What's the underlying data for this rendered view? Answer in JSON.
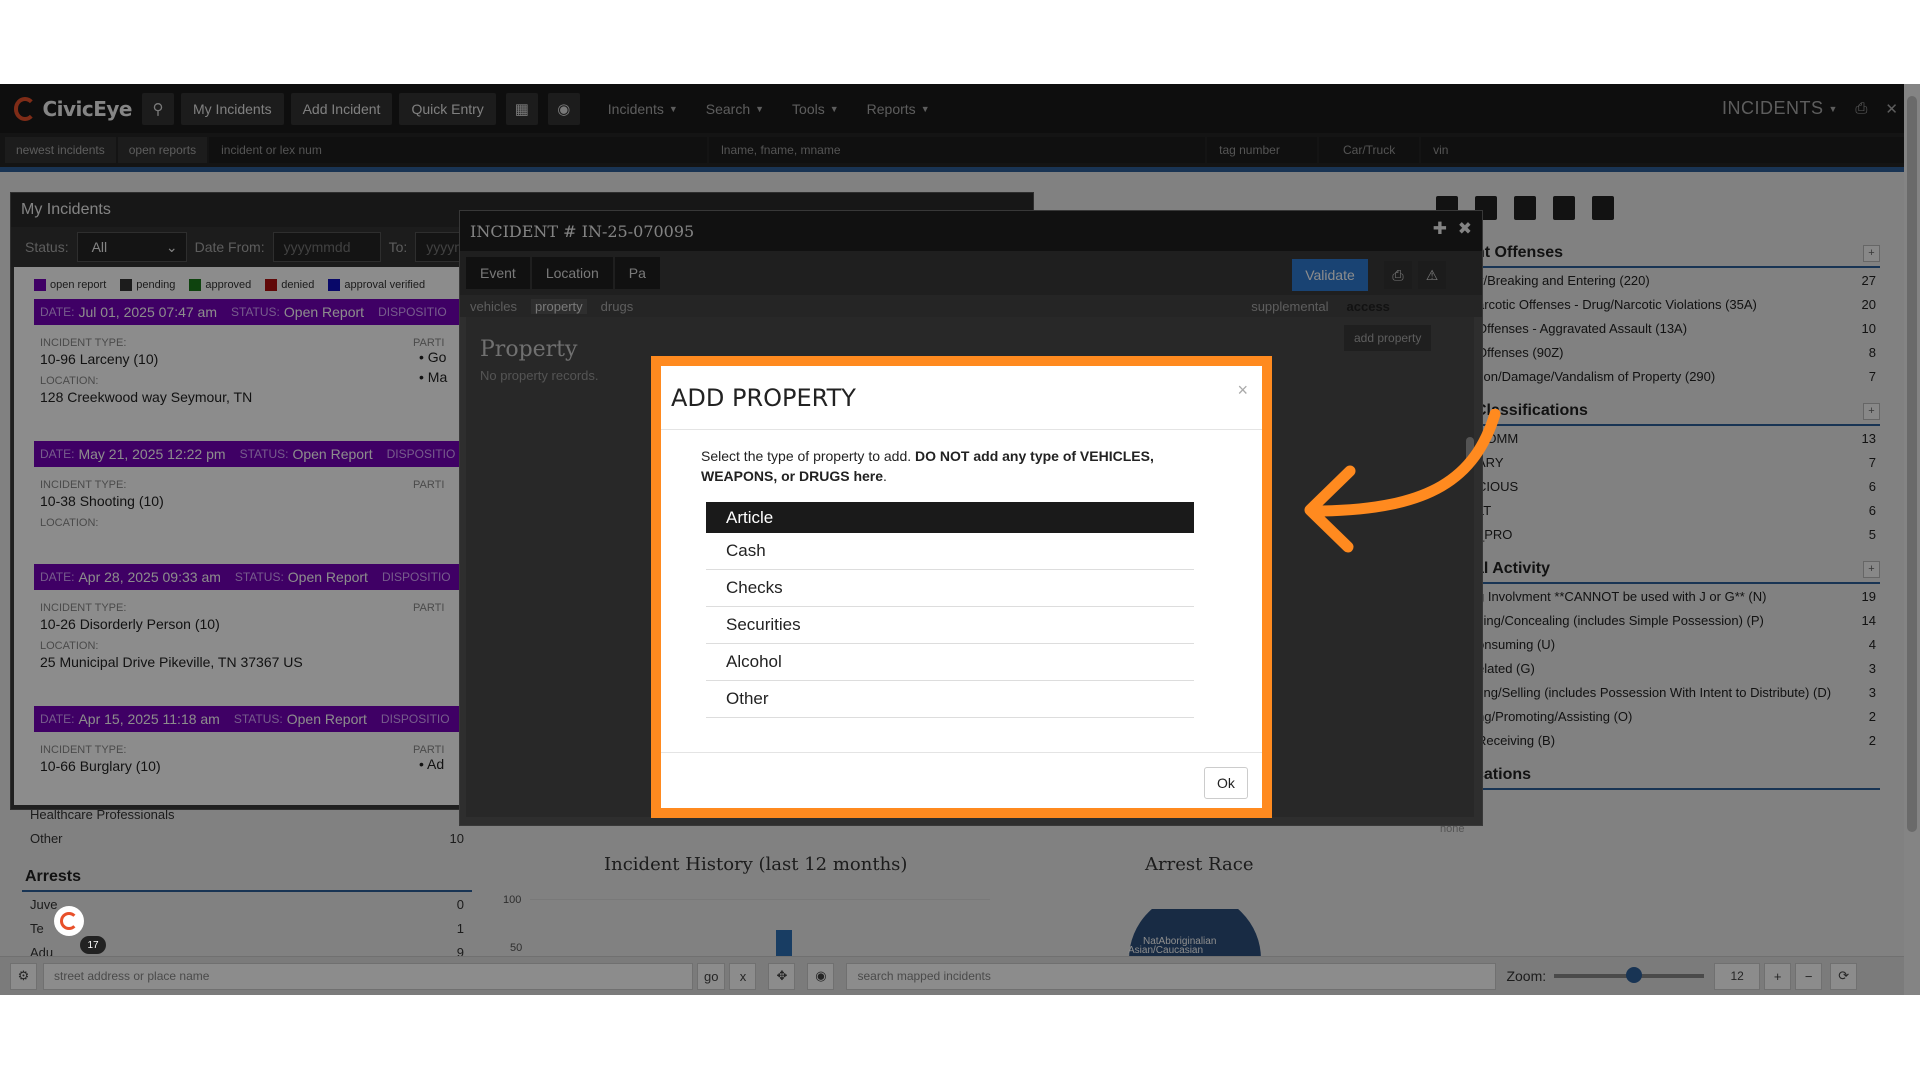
{
  "navbar": {
    "brand": "CivicEye",
    "buttons": [
      "My Incidents",
      "Add Incident",
      "Quick Entry"
    ],
    "menus": [
      "Incidents",
      "Search",
      "Tools",
      "Reports"
    ],
    "section_title": "INCIDENTS"
  },
  "searchbar": {
    "newest": "newest incidents",
    "open_reports": "open reports",
    "incident_placeholder": "incident or lex num",
    "name_placeholder": "lname, fname, mname",
    "tag_placeholder": "tag number",
    "vehicle_type": "Car/Truck",
    "vin_placeholder": "vin"
  },
  "my_incidents": {
    "title": "My Incidents",
    "status_label": "Status:",
    "status_value": "All",
    "date_from_label": "Date From:",
    "date_placeholder": "yyyymmdd",
    "to_label": "To:",
    "to_placeholder": "yyyymm",
    "legend": [
      {
        "label": "open report",
        "color": "#7400b8"
      },
      {
        "label": "pending",
        "color": "#333333"
      },
      {
        "label": "approved",
        "color": "#1a7a1a"
      },
      {
        "label": "denied",
        "color": "#b01010"
      },
      {
        "label": "approval verified",
        "color": "#1010c0"
      }
    ],
    "date_label": "DATE:",
    "status_bar_label": "STATUS:",
    "disposition_label": "DISPOSITIO",
    "incident_type_label": "INCIDENT TYPE:",
    "location_label": "LOCATION:",
    "parties_label": "PARTI",
    "incidents": [
      {
        "date": "Jul 01, 2025 07:47 am",
        "status": "Open Report",
        "type": "10-96 Larceny (10)",
        "location": "128 Creekwood way Seymour, TN",
        "parties": [
          "Go",
          "Ma"
        ]
      },
      {
        "date": "May 21, 2025 12:22 pm",
        "status": "Open Report",
        "type": "10-38 Shooting (10)",
        "location": "",
        "parties": []
      },
      {
        "date": "Apr 28, 2025 09:33 am",
        "status": "Open Report",
        "type": "10-26 Disorderly Person (10)",
        "location": "25 Municipal Drive Pikeville, TN 37367 US",
        "parties": []
      },
      {
        "date": "Apr 15, 2025 11:18 am",
        "status": "Open Report",
        "type": "10-66 Burglary (10)",
        "location": "",
        "parties": [
          "Ad"
        ]
      }
    ]
  },
  "incident_modal": {
    "title": "INCIDENT # IN-25-070095",
    "tabs": [
      "Event",
      "Location",
      "Pa"
    ],
    "validate": "Validate",
    "subtabs": [
      "vehicles",
      "property",
      "drugs"
    ],
    "subtabs_right": [
      "supplemental",
      "access"
    ],
    "heading": "Property",
    "empty": "No property records.",
    "add_property": "add property"
  },
  "add_property": {
    "title": "ADD PROPERTY",
    "close": "×",
    "desc_plain": "Select the type of property to add.",
    "desc_bold": "DO NOT add any type of VEHICLES, WEAPONS, or DRUGS here",
    "desc_end": ".",
    "options": [
      "Article",
      "Cash",
      "Checks",
      "Securities",
      "Alcohol",
      "Other"
    ],
    "selected": "Article",
    "ok": "Ok"
  },
  "side_panel": {
    "sections": [
      {
        "title": "nt Offenses",
        "rows": [
          {
            "label": "y/Breaking and Entering (220)",
            "value": "27"
          },
          {
            "label": "arcotic Offenses - Drug/Narcotic Violations (35A)",
            "value": "20"
          },
          {
            "label": " Offenses - Aggravated Assault (13A)",
            "value": "10"
          },
          {
            "label": " Offenses (90Z)",
            "value": "8"
          },
          {
            "label": "tion/Damage/Vandalism of Property (290)",
            "value": "7"
          }
        ]
      },
      {
        "title": "Classifications",
        "rows": [
          {
            "label": " COMM",
            "value": "13"
          },
          {
            "label": "ARY",
            "value": "7"
          },
          {
            "label": "CIOUS",
            "value": "6"
          },
          {
            "label": "LT",
            "value": "6"
          },
          {
            "label": "_PRO",
            "value": "5"
          }
        ]
      },
      {
        "title": "al Activity",
        "rows": [
          {
            "label": "g Involvment **CANNOT be used with J or G** (N)",
            "value": "19"
          },
          {
            "label": "sing/Concealing (includes Simple Possession) (P)",
            "value": "14"
          },
          {
            "label": "onsuming (U)",
            "value": "4"
          },
          {
            "label": "elated (G)",
            "value": "3"
          },
          {
            "label": "ting/Selling (includes Possession With Intent to Distribute) (D)",
            "value": "3"
          },
          {
            "label": "ng/Promoting/Assisting (O)",
            "value": "2"
          },
          {
            "label": "Receiving (B)",
            "value": "2"
          }
        ]
      },
      {
        "title": "cations",
        "rows": []
      }
    ]
  },
  "left_under": {
    "rows_top": [
      {
        "label": "Healthcare Professionals",
        "value": ""
      },
      {
        "label": "Other",
        "value": "10"
      }
    ],
    "arrests_title": "Arrests",
    "arrests": [
      {
        "label": "Juve",
        "value": "0"
      },
      {
        "label": "Te",
        "value": "1"
      },
      {
        "label": "Adu",
        "value": "9"
      }
    ]
  },
  "charts": {
    "history_title": "Incident History (last 12 months)",
    "arrest_title": "Arrest Race",
    "tick_100": "100",
    "tick_50": "50",
    "pie_label": "NatAboriginalian",
    "pie_label2": "Asian/Caucasian",
    "hone": "hone"
  },
  "map_bar": {
    "address_placeholder": "street address or place name",
    "go": "go",
    "x": "x",
    "search_placeholder": "search mapped incidents",
    "zoom_label": "Zoom:",
    "zoom_value": "12"
  },
  "chat": {
    "count": "17"
  }
}
